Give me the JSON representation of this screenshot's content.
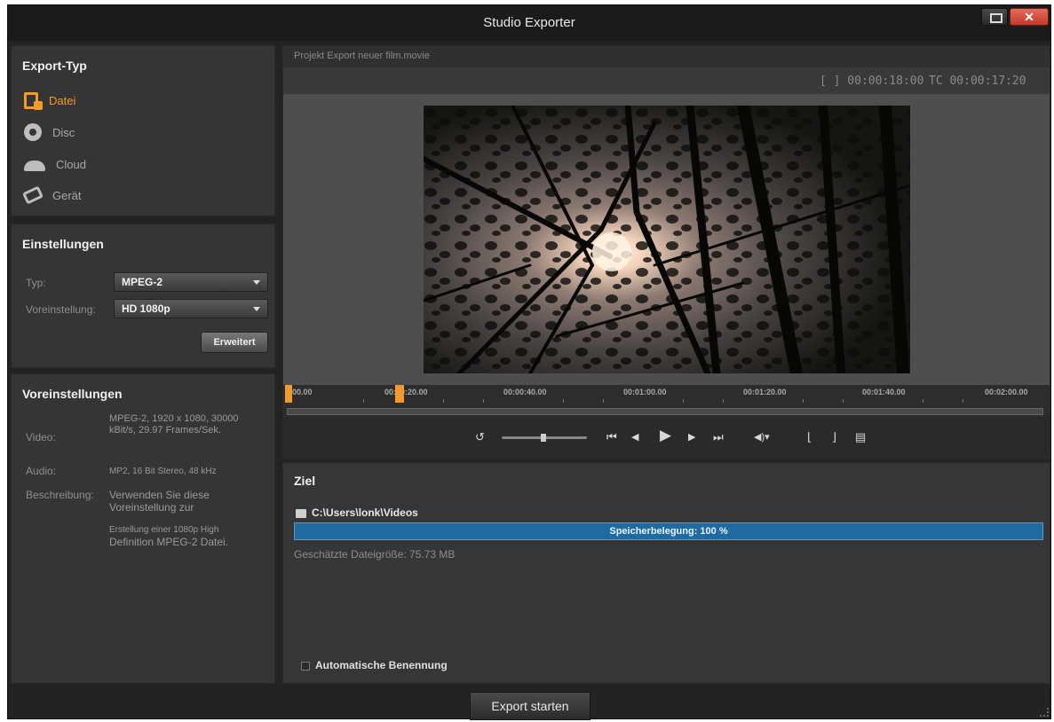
{
  "window": {
    "title": "Studio Exporter",
    "close_label": "✕",
    "accent_color": "#f29a2c",
    "progress_color": "#1f6aa0"
  },
  "export_type": {
    "title": "Export-Typ",
    "items": [
      {
        "label": "Datei",
        "icon": "file-icon",
        "active": true
      },
      {
        "label": "Disc",
        "icon": "disc-icon",
        "active": false
      },
      {
        "label": "Cloud",
        "icon": "cloud-icon",
        "active": false
      },
      {
        "label": "Gerät",
        "icon": "device-icon",
        "active": false
      }
    ]
  },
  "settings": {
    "title": "Einstellungen",
    "type_label": "Typ:",
    "type_value": "MPEG-2",
    "preset_label": "Voreinstellung:",
    "preset_value": "HD 1080p",
    "advanced_label": "Erweitert"
  },
  "presets": {
    "title": "Voreinstellungen",
    "video_label": "Video:",
    "video_value": "MPEG-2, 1920 x 1080, 30000 kBit/s, 29.97 Frames/Sek.",
    "audio_label": "Audio:",
    "audio_value": "MP2, 16 Bit Stereo, 48 kHz",
    "description_label": "Beschreibung:",
    "description_value_1": "Verwenden Sie diese Voreinstellung zur",
    "description_value_2": "Erstellung einer 1080p High",
    "description_value_3": "Definition MPEG-2 Datei."
  },
  "preview": {
    "project_title": "Projekt Export neuer film.movie",
    "duration": "[ ] 00:00:18:00",
    "timecode": "TC 00:00:17:20",
    "timeline_labels": [
      "00.00",
      "00:00:20.00",
      "00:00:40.00",
      "00:01:00.00",
      "00:01:20.00",
      "00:01:40.00",
      "00:02:00.00"
    ]
  },
  "transport": {
    "loop_icon": "↺",
    "to_start_icon": "⏮",
    "step_back_icon": "◀",
    "play_icon": "▶",
    "step_forward_icon": "▶",
    "to_end_icon": "⏭",
    "volume_icon": "◀)▾",
    "mark_in_icon": "⌊",
    "mark_out_icon": "⌋",
    "snapshot_icon": "▤"
  },
  "target": {
    "title": "Ziel",
    "folder_path": "C:\\Users\\lonk\\Videos",
    "storage_label": "Speicherbelegung: 100 %",
    "storage_fraction": 1.0,
    "estimated_size": "Geschätzte Dateigröße: 75.73 MB",
    "auto_rename_label": "Automatische Benennung"
  },
  "footer": {
    "export_label": "Export starten"
  }
}
